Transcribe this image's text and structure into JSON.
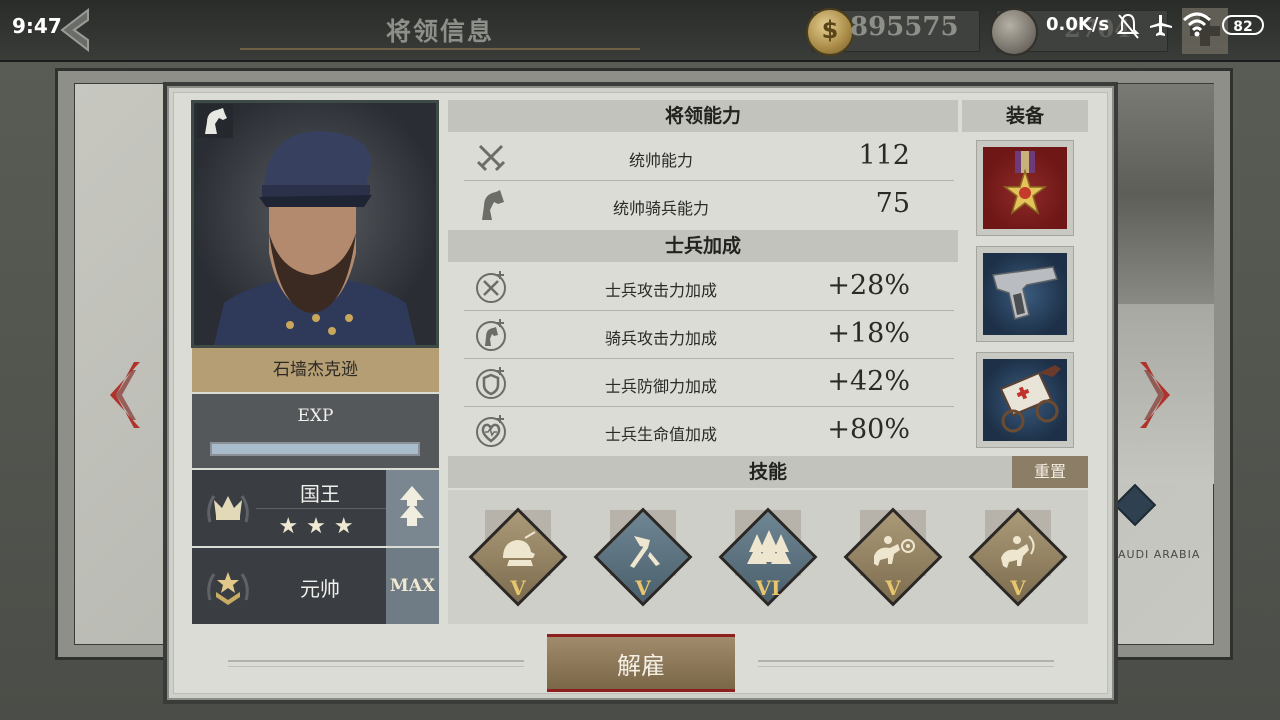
{
  "status_bar": {
    "time": "9:47",
    "net_speed": "0.0K/s",
    "battery": "82"
  },
  "header": {
    "title": "将领信息",
    "coins": "895575",
    "medals": "2704"
  },
  "map": {
    "region_label": "AUDI ARABIA"
  },
  "general": {
    "name": "石墙杰克逊",
    "exp_label": "EXP",
    "exp_fill": 1.0,
    "rank_title": "国王",
    "stars": "★★★",
    "military_rank": "元帅",
    "max_label": "MAX"
  },
  "abilities": {
    "header": "将领能力",
    "items": [
      {
        "icon": "crossed-swords-icon",
        "label": "统帅能力",
        "value": "112"
      },
      {
        "icon": "horse-head-icon",
        "label": "统帅骑兵能力",
        "value": "75"
      }
    ]
  },
  "soldier_bonus": {
    "header": "士兵加成",
    "items": [
      {
        "icon": "swords-plus-icon",
        "label": "士兵攻击力加成",
        "value": "+28%"
      },
      {
        "icon": "horse-plus-icon",
        "label": "骑兵攻击力加成",
        "value": "+18%"
      },
      {
        "icon": "shield-plus-icon",
        "label": "士兵防御力加成",
        "value": "+42%"
      },
      {
        "icon": "heart-plus-icon",
        "label": "士兵生命值加成",
        "value": "+80%"
      }
    ]
  },
  "equipment": {
    "header": "装备",
    "items": [
      "medal-icon",
      "pistol-icon",
      "ambulance-wagon-icon"
    ]
  },
  "skills": {
    "header": "技能",
    "reset_label": "重置",
    "items": [
      {
        "icon": "soldier-helmet-icon",
        "level": "V",
        "style": "gold"
      },
      {
        "icon": "hammer-tool-icon",
        "level": "V",
        "style": "blue"
      },
      {
        "icon": "forest-icon",
        "level": "VI",
        "style": "blue"
      },
      {
        "icon": "cavalry-charge-icon",
        "level": "V",
        "style": "gold"
      },
      {
        "icon": "cavalry-rider-icon",
        "level": "V",
        "style": "gold"
      }
    ]
  },
  "footer": {
    "dismiss_label": "解雇"
  },
  "colors": {
    "accent_gold": "#b59e73",
    "dismiss_red": "#8e1f1f",
    "skill_level": "#e7c66d"
  }
}
